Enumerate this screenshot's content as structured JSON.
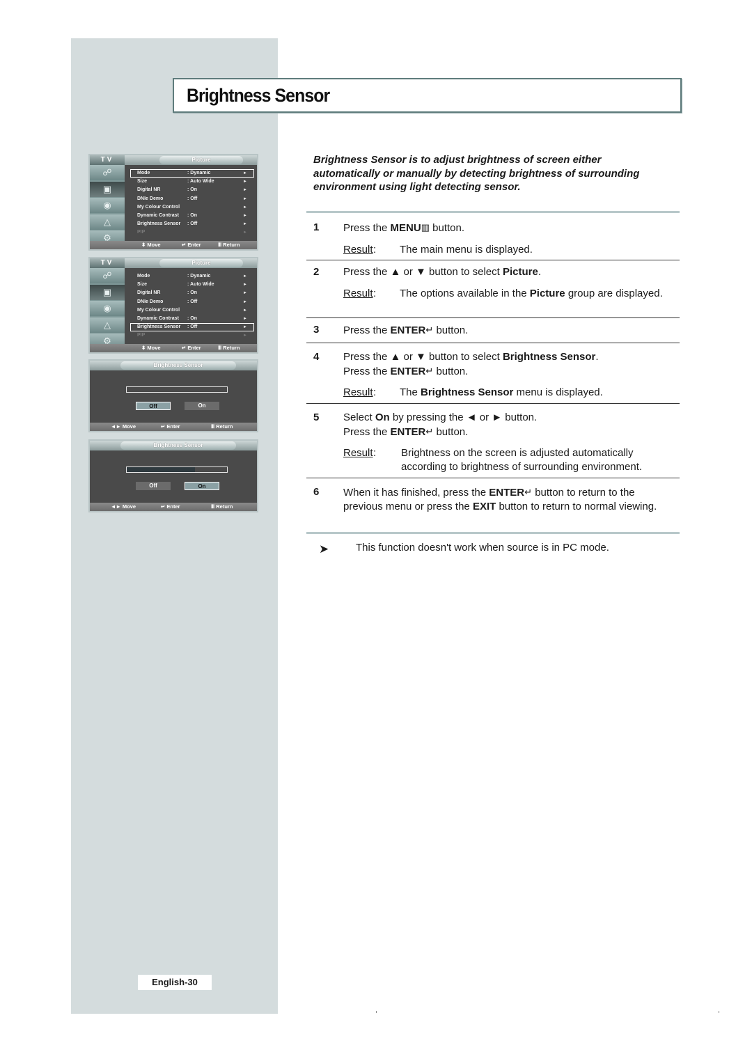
{
  "page": {
    "title": "Brightness Sensor",
    "page_number": "English-30"
  },
  "intro": "Brightness Sensor is to adjust brightness of screen either automatically or manually by detecting brightness of surrounding environment using light detecting sensor.",
  "result_label": "Result",
  "steps": [
    {
      "num": "1",
      "pre": "Press the ",
      "b1": "MENU",
      "icon": "menu-icon",
      "glyph": "▥",
      "post": " button.",
      "result": "The main menu is displayed."
    },
    {
      "num": "2",
      "pre": "Press the ▲ or ▼ button to select ",
      "b1": "Picture",
      "post": ".",
      "result_pre": "The options available in the ",
      "result_b": "Picture",
      "result_post": " group are displayed."
    },
    {
      "num": "3",
      "pre": "Press the ",
      "b1": "ENTER",
      "glyph": "↵",
      "post": " button."
    },
    {
      "num": "4",
      "pre": "Press the ▲ or ▼ button to select ",
      "b1": "Brightness Sensor",
      "post": ".",
      "line2_pre": "Press the ",
      "line2_b": "ENTER",
      "line2_glyph": "↵",
      "line2_post": " button.",
      "result_pre": "The ",
      "result_b": "Brightness Sensor",
      "result_post": " menu is displayed."
    },
    {
      "num": "5",
      "pre": "Select ",
      "b1": "On",
      "post": " by pressing the ◄ or ► button.",
      "line2_pre": "Press the ",
      "line2_b": "ENTER",
      "line2_glyph": "↵",
      "line2_post": " button.",
      "result": "Brightness on the screen is adjusted automatically according to brightness of surrounding environment."
    },
    {
      "num": "6",
      "pre": "When it has finished, press the ",
      "b1": "ENTER",
      "glyph": "↵",
      "mid": " button to return to the previous menu or press the ",
      "b2": "EXIT",
      "post": " button to return to normal viewing."
    }
  ],
  "note": {
    "icon": "note-arrow-icon",
    "glyph": "➤",
    "text": "This function doesn't work when source is in PC mode."
  },
  "osd": {
    "tv_label": "TV",
    "menu_tab": "Picture",
    "dialog_tab": "Brightness Sensor",
    "menu_items": [
      {
        "label": "Mode",
        "value": ": Dynamic"
      },
      {
        "label": "Size",
        "value": ": Auto Wide"
      },
      {
        "label": "Digital NR",
        "value": ": On"
      },
      {
        "label": "DNIe Demo",
        "value": ": Off"
      },
      {
        "label": "My Colour Control",
        "value": ""
      },
      {
        "label": "Dynamic Contrast",
        "value": ": On"
      },
      {
        "label": "Brightness Sensor",
        "value": ": Off"
      },
      {
        "label": "PIP",
        "value": ""
      }
    ],
    "arrow": "►",
    "footer_menu": {
      "move": "⬍ Move",
      "enter": "↵ Enter",
      "return": "Ⅲ Return"
    },
    "footer_dialog": {
      "move": "◄► Move",
      "enter": "↵ Enter",
      "return": "Ⅲ Return"
    },
    "screens": [
      {
        "highlighted": "Mode"
      },
      {
        "highlighted": "Brightness Sensor"
      },
      {
        "selected_option": "Off",
        "bar_level": 0.0
      },
      {
        "selected_option": "On",
        "bar_level": 0.68
      }
    ],
    "options": [
      "Off",
      "On"
    ]
  }
}
